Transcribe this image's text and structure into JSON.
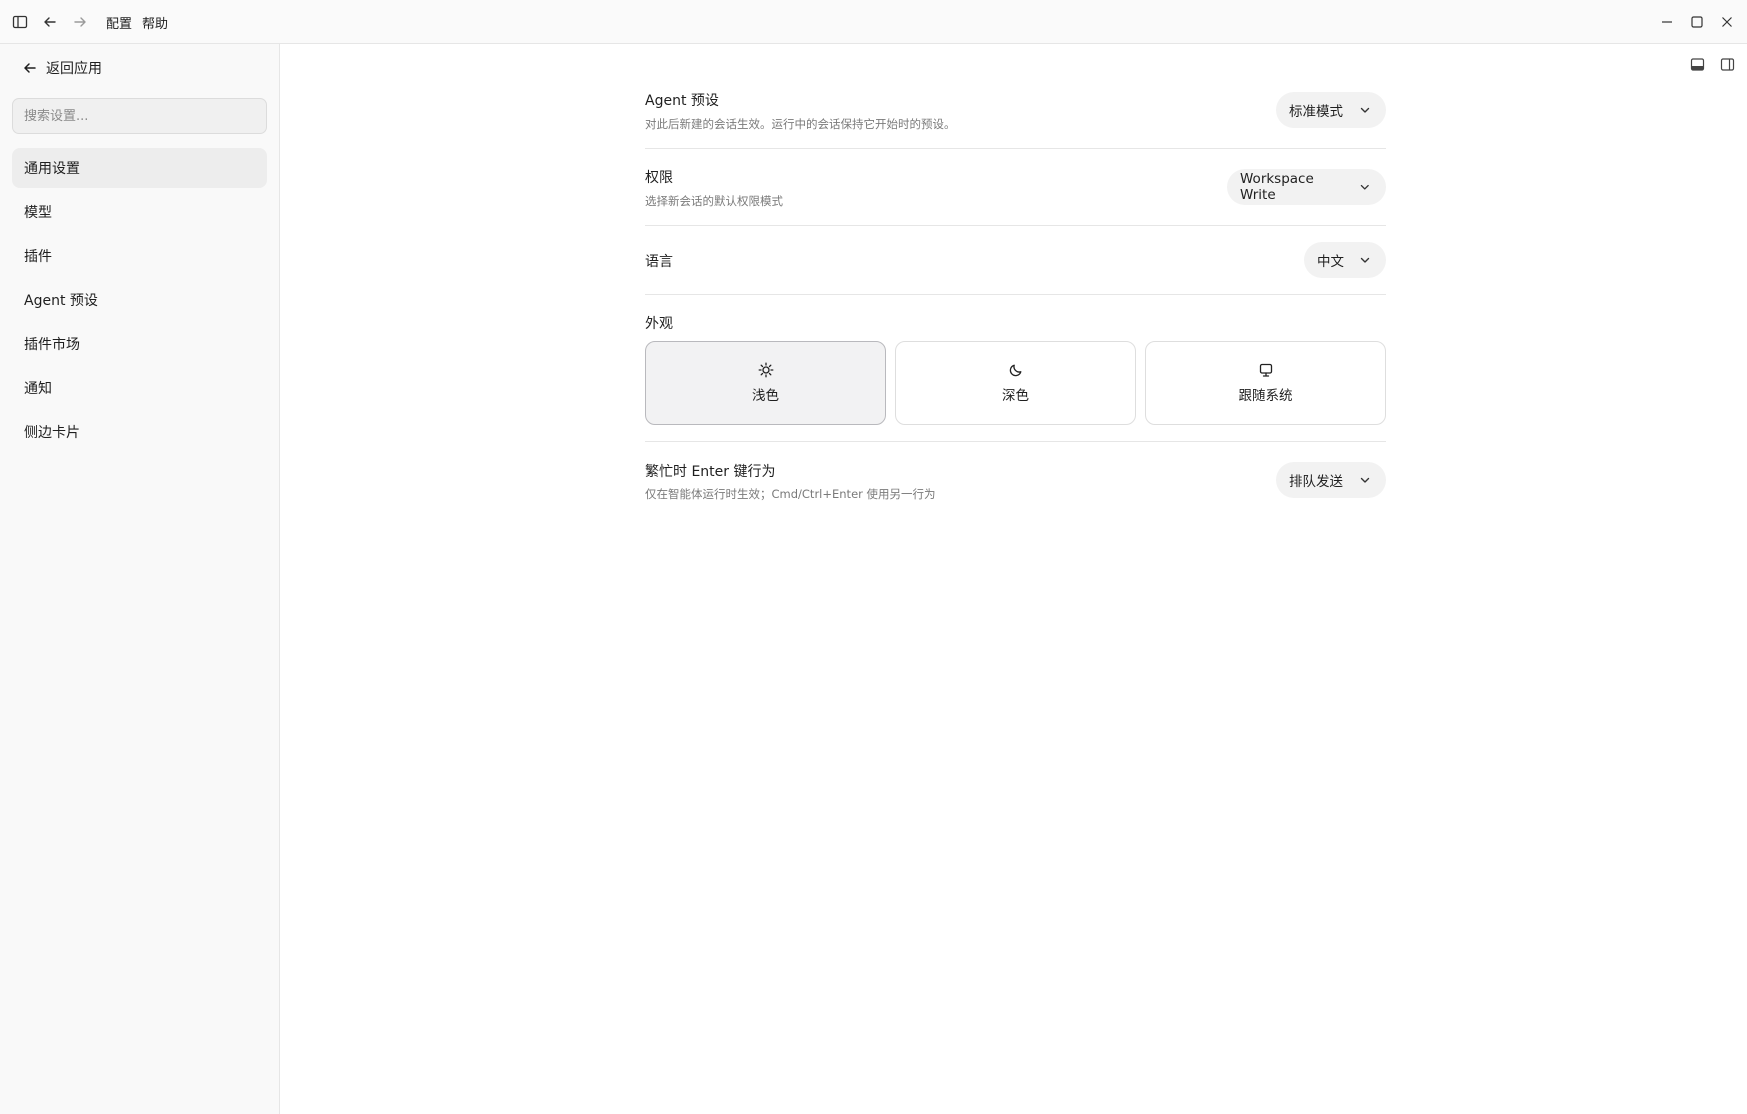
{
  "titlebar": {
    "menu": [
      "配置",
      "帮助"
    ],
    "icons": [
      "sidebar-toggle-icon",
      "arrow-left-icon",
      "arrow-right-icon",
      "minimize-icon",
      "maximize-icon",
      "close-icon"
    ]
  },
  "sidebar": {
    "back_label": "返回应用",
    "search_placeholder": "搜索设置...",
    "items": [
      {
        "label": "通用设置",
        "active": true
      },
      {
        "label": "模型",
        "active": false
      },
      {
        "label": "插件",
        "active": false
      },
      {
        "label": "Agent 预设",
        "active": false
      },
      {
        "label": "插件市场",
        "active": false
      },
      {
        "label": "通知",
        "active": false
      },
      {
        "label": "侧边卡片",
        "active": false
      }
    ]
  },
  "settings": {
    "agent_preset": {
      "title": "Agent 预设",
      "description": "对此后新建的会话生效。运行中的会话保持它开始时的预设。",
      "value": "标准模式"
    },
    "permission": {
      "title": "权限",
      "description": "选择新会话的默认权限模式",
      "value": "Workspace Write"
    },
    "language": {
      "title": "语言",
      "value": "中文"
    },
    "appearance": {
      "title": "外观",
      "options": [
        {
          "label": "浅色",
          "icon": "sun-icon",
          "selected": true
        },
        {
          "label": "深色",
          "icon": "moon-icon",
          "selected": false
        },
        {
          "label": "跟随系统",
          "icon": "monitor-icon",
          "selected": false
        }
      ]
    },
    "busy_enter": {
      "title": "繁忙时 Enter 键行为",
      "description": "仅在智能体运行时生效；Cmd/Ctrl+Enter 使用另一行为",
      "value": "排队发送"
    }
  }
}
